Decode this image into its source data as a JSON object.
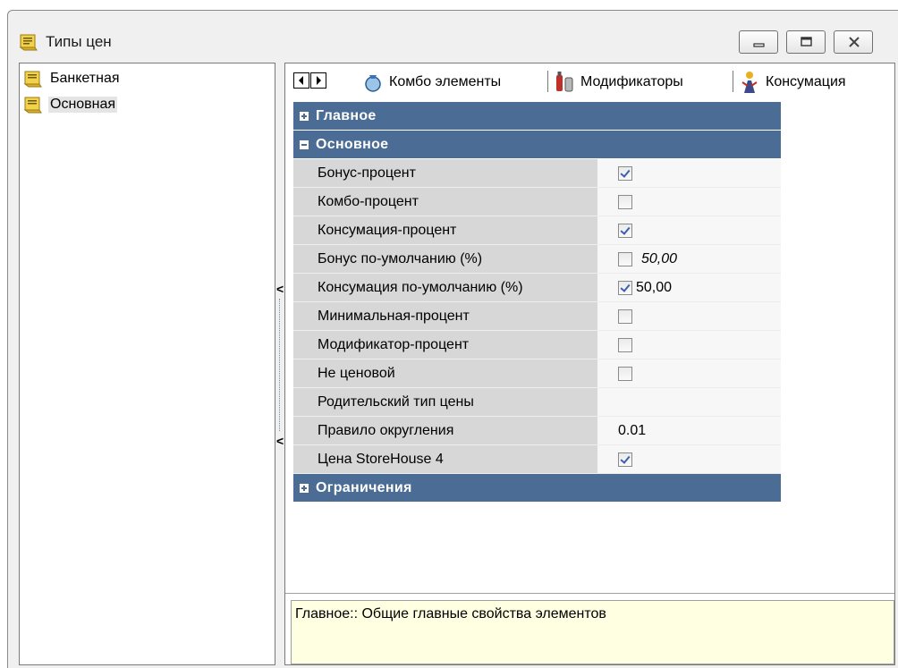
{
  "window": {
    "title": "Типы цен"
  },
  "tree": {
    "items": [
      {
        "label": "Банкетная",
        "selected": false
      },
      {
        "label": "Основная",
        "selected": true
      }
    ]
  },
  "tabs": [
    {
      "label": "Комбо элементы",
      "icon": "combo-icon"
    },
    {
      "label": "Модификаторы",
      "icon": "modifiers-icon"
    },
    {
      "label": "Консумация",
      "icon": "consumption-icon"
    }
  ],
  "properties": {
    "group_main": "Главное",
    "group_basic": "Основное",
    "group_limits": "Ограничения",
    "rows": [
      {
        "name": "Бонус-процент",
        "checked": true,
        "value": ""
      },
      {
        "name": "Комбо-процент",
        "checked": false,
        "value": ""
      },
      {
        "name": "Консумация-процент",
        "checked": true,
        "value": ""
      },
      {
        "name": "Бонус по-умолчанию (%)",
        "checked": false,
        "value": "50,00"
      },
      {
        "name": "Консумация по-умолчанию (%)",
        "checked": true,
        "value": "50,00"
      },
      {
        "name": "Минимальная-процент",
        "checked": false,
        "value": ""
      },
      {
        "name": "Модификатор-процент",
        "checked": false,
        "value": ""
      },
      {
        "name": "Не ценовой",
        "checked": false,
        "value": ""
      },
      {
        "name": "Родительский тип цены",
        "checked": null,
        "value": ""
      },
      {
        "name": "Правило округления",
        "checked": null,
        "value": "0.01"
      },
      {
        "name": "Цена StoreHouse 4",
        "checked": true,
        "value": ""
      }
    ]
  },
  "description": "Главное:: Общие главные свойства элементов",
  "colors": {
    "group_header": "#4a6c95",
    "name_cell": "#d7d7d7",
    "description_bg": "#ffffe1"
  }
}
